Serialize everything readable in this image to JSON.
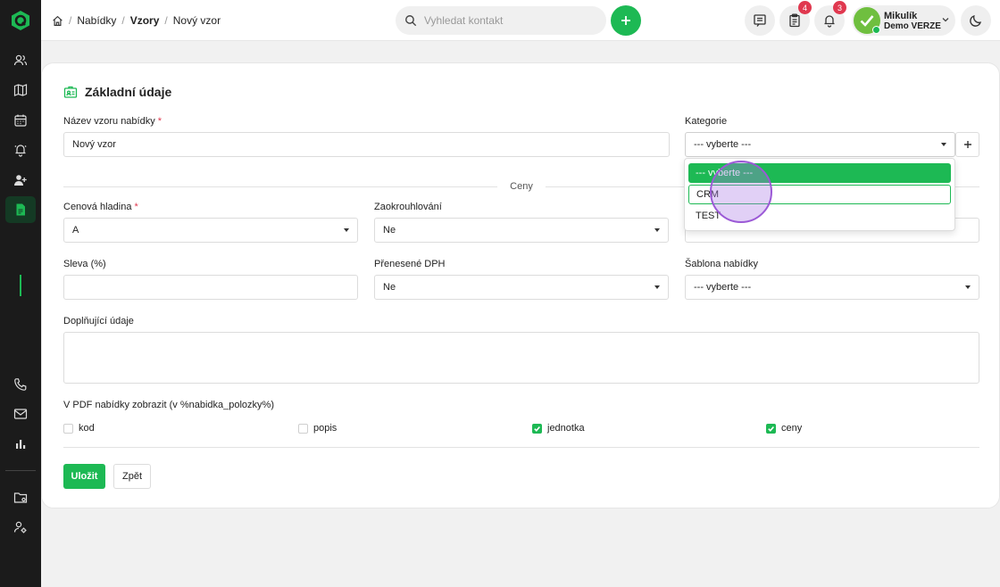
{
  "sidebar": {
    "items": [
      {
        "icon": "users-icon"
      },
      {
        "icon": "map-icon"
      },
      {
        "icon": "calendar-icon"
      },
      {
        "icon": "bell-icon"
      },
      {
        "icon": "user-add-icon"
      },
      {
        "icon": "document-icon",
        "active": true
      },
      {
        "icon": "phone-icon"
      },
      {
        "icon": "mail-icon"
      },
      {
        "icon": "chart-icon"
      },
      {
        "icon": "folder-settings-icon"
      },
      {
        "icon": "user-settings-icon"
      }
    ]
  },
  "breadcrumb": {
    "items": [
      "Nabídky",
      "Vzory",
      "Nový vzor"
    ]
  },
  "search": {
    "placeholder": "Vyhledat kontakt"
  },
  "header": {
    "tasks_badge": "4",
    "notifications_badge": "3"
  },
  "user": {
    "name": "Mikulík",
    "org": "Demo VERZE"
  },
  "form": {
    "title": "Základní údaje",
    "name_label": "Název vzoru nabídky",
    "name_value": "Nový vzor",
    "category_label": "Kategorie",
    "category_value": "--- vyberte ---",
    "section_prices": "Ceny",
    "price_level_label": "Cenová hladina",
    "price_level_value": "A",
    "rounding_label": "Zaokrouhlování",
    "rounding_value": "Ne",
    "discount_label": "Sleva (%)",
    "discount_value": "",
    "vat_label": "Přenesené DPH",
    "vat_value": "Ne",
    "template_label": "Šablona nabídky",
    "template_value": "--- vyberte ---",
    "extra_label": "Doplňující údaje",
    "extra_value": "",
    "pdf_label": "V PDF nabídky zobrazit (v %nabidka_polozky%)",
    "checks": [
      {
        "label": "kod",
        "checked": false
      },
      {
        "label": "popis",
        "checked": false
      },
      {
        "label": "jednotka",
        "checked": true
      },
      {
        "label": "ceny",
        "checked": true
      }
    ],
    "save_label": "Uložit",
    "back_label": "Zpět"
  },
  "category_dropdown": {
    "options": [
      "--- vyberte ---",
      "CRM",
      "TEST"
    ]
  },
  "colors": {
    "accent": "#1db954",
    "badge": "#e0384f",
    "sidebar": "#1b1b1b"
  }
}
